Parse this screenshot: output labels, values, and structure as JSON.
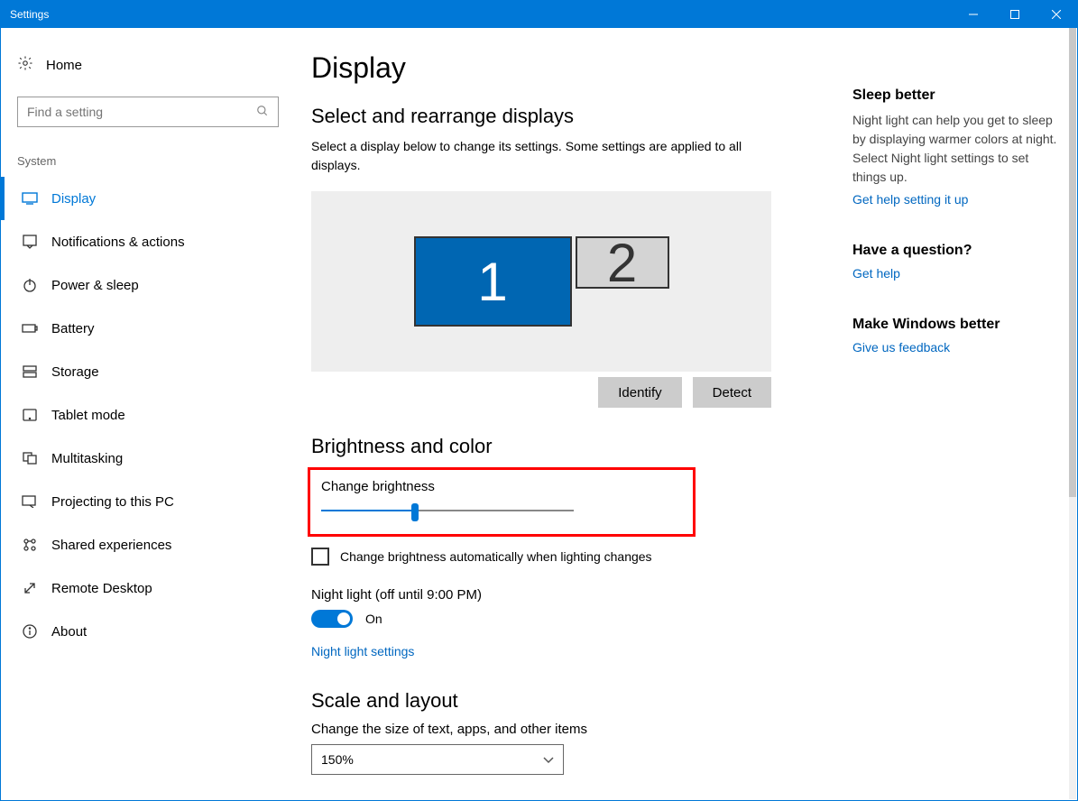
{
  "window": {
    "title": "Settings"
  },
  "sidebar": {
    "home": "Home",
    "search_placeholder": "Find a setting",
    "group": "System",
    "items": [
      {
        "label": "Display",
        "icon": "display-icon",
        "active": true
      },
      {
        "label": "Notifications & actions",
        "icon": "notifications-icon"
      },
      {
        "label": "Power & sleep",
        "icon": "power-icon"
      },
      {
        "label": "Battery",
        "icon": "battery-icon"
      },
      {
        "label": "Storage",
        "icon": "storage-icon"
      },
      {
        "label": "Tablet mode",
        "icon": "tablet-icon"
      },
      {
        "label": "Multitasking",
        "icon": "multitasking-icon"
      },
      {
        "label": "Projecting to this PC",
        "icon": "projecting-icon"
      },
      {
        "label": "Shared experiences",
        "icon": "shared-icon"
      },
      {
        "label": "Remote Desktop",
        "icon": "remote-icon"
      },
      {
        "label": "About",
        "icon": "about-icon"
      }
    ]
  },
  "page": {
    "title": "Display",
    "sections": {
      "arrange": {
        "heading": "Select and rearrange displays",
        "help": "Select a display below to change its settings. Some settings are applied to all displays.",
        "monitor1": "1",
        "monitor2": "2",
        "identify": "Identify",
        "detect": "Detect"
      },
      "brightness": {
        "heading": "Brightness and color",
        "change_label": "Change brightness",
        "slider_value_pct": 37,
        "auto_label": "Change brightness automatically when lighting changes",
        "auto_checked": false,
        "nightlight_label": "Night light (off until 9:00 PM)",
        "nightlight_on": true,
        "nightlight_state": "On",
        "nightlight_link": "Night light settings"
      },
      "scale": {
        "heading": "Scale and layout",
        "size_label": "Change the size of text, apps, and other items",
        "size_value": "150%"
      }
    }
  },
  "aside": {
    "sleep": {
      "heading": "Sleep better",
      "body": "Night light can help you get to sleep by displaying warmer colors at night. Select Night light settings to set things up.",
      "link": "Get help setting it up"
    },
    "question": {
      "heading": "Have a question?",
      "link": "Get help"
    },
    "feedback": {
      "heading": "Make Windows better",
      "link": "Give us feedback"
    }
  }
}
